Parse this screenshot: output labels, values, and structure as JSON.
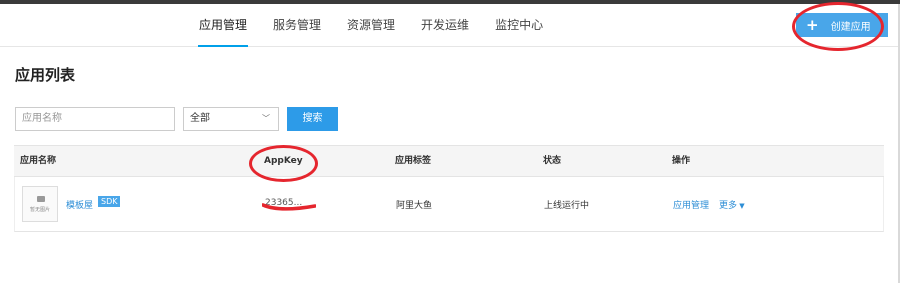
{
  "nav": {
    "items": [
      {
        "label": "应用管理",
        "active": true
      },
      {
        "label": "服务管理",
        "active": false
      },
      {
        "label": "资源管理",
        "active": false
      },
      {
        "label": "开发运维",
        "active": false
      },
      {
        "label": "监控中心",
        "active": false
      }
    ],
    "create_button": {
      "label": "创建应用",
      "icon": "plus-icon"
    }
  },
  "page": {
    "title": "应用列表"
  },
  "filters": {
    "search_placeholder": "应用名称",
    "select_value": "全部",
    "search_button": "搜索"
  },
  "table": {
    "columns": [
      "应用名称",
      "AppKey",
      "应用标签",
      "状态",
      "操作"
    ],
    "rows": [
      {
        "thumb_caption": "暂无图片",
        "name": "模板屋",
        "badge": "SDK",
        "appkey": "23365...",
        "tag": "阿里大鱼",
        "status": "上线运行中",
        "actions": [
          "应用管理",
          "更多"
        ]
      }
    ]
  },
  "colors": {
    "accent": "#2d9be8",
    "create_button": "#49a6e9",
    "link": "#2d8ed6",
    "annotation": "#e5262e"
  }
}
